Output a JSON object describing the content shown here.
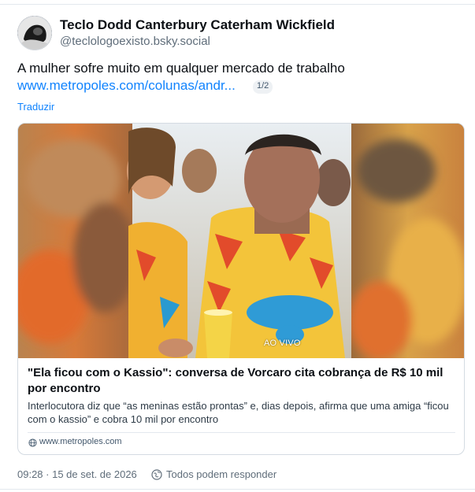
{
  "author": {
    "display_name": "Teclo Dodd Canterbury Caterham Wickfield",
    "handle": "@teclologoexisto.bsky.social",
    "avatar_icon": "avatar-image"
  },
  "post": {
    "text": "A mulher sofre muito em qualquer mercado de trabalho",
    "link_text": "www.metropoles.com/colunas/andr...",
    "link_count": "1/2",
    "translate_label": "Traduzir"
  },
  "embed": {
    "thumbnail_overlay": "AO VIVO",
    "title": "\"Ela ficou com o Kassio\": conversa de Vorcaro cita cobrança de R$ 10 mil por encontro",
    "description": "Interlocutora diz que “as meninas estão prontas” e, dias depois, afirma que uma amiga “ficou com o kassio” e cobra 10 mil por encontro",
    "domain": "www.metropoles.com",
    "domain_icon": "globe-icon"
  },
  "footer": {
    "timestamp": "09:28 · 15 de set. de 2026",
    "reply_setting": "Todos podem responder",
    "reply_icon": "globe-reply-icon"
  },
  "colors": {
    "link": "#1083fe",
    "text": "#0b0f14",
    "muted": "#5f6d7a",
    "border": "#d4dbe2"
  }
}
